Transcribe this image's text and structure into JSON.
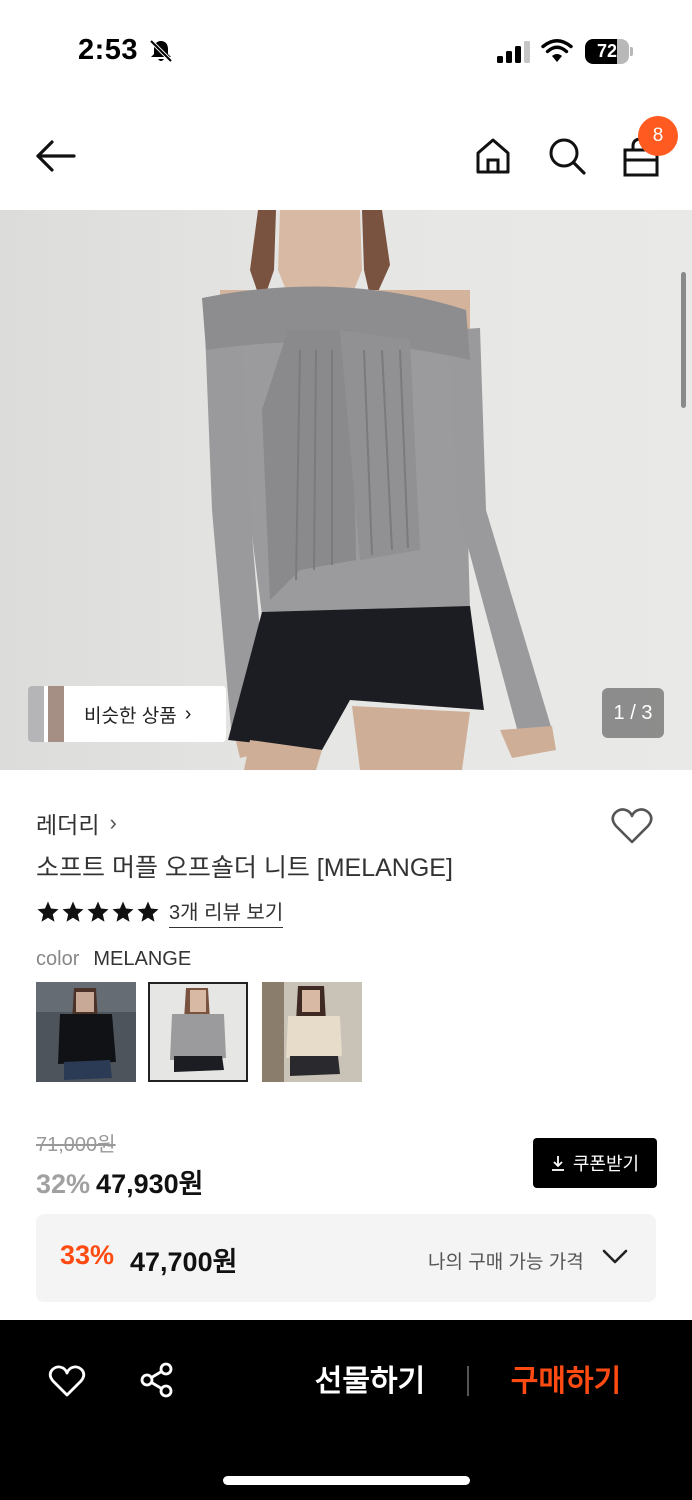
{
  "status_bar": {
    "time": "2:53",
    "battery": "72",
    "battery_level": 0.72,
    "icons": [
      "bell-slash-icon",
      "cellular-signal-icon",
      "wifi-icon",
      "battery-icon"
    ]
  },
  "header": {
    "icons": [
      "back-arrow-icon",
      "home-icon",
      "search-icon",
      "shopping-bag-icon"
    ],
    "cart_count": "8"
  },
  "gallery": {
    "similar_label": "비슷한 상품",
    "page_indicator": "1 / 3",
    "current_page": 1,
    "total_pages": 3
  },
  "product": {
    "brand": "레더리",
    "title": "소프트 머플 오프숄더 니트 [MELANGE]",
    "rating_stars": 5,
    "review_link": "3개 리뷰 보기",
    "color_label": "color",
    "color_value": "MELANGE",
    "color_options": [
      "black",
      "melange",
      "beige"
    ],
    "selected_color_index": 1
  },
  "price": {
    "original": "71,000원",
    "discount_rate": "32%",
    "sale": "47,930원",
    "coupon_label": "쿠폰받기",
    "best_rate": "33%",
    "best_amount": "47,700원",
    "best_label": "나의 구매 가능 가격"
  },
  "bottom_bar": {
    "gift_label": "선물하기",
    "buy_label": "구매하기"
  },
  "colors": {
    "accent": "#ff4b12",
    "badge": "#ff5a1f",
    "bottom_bar": "#000000"
  }
}
